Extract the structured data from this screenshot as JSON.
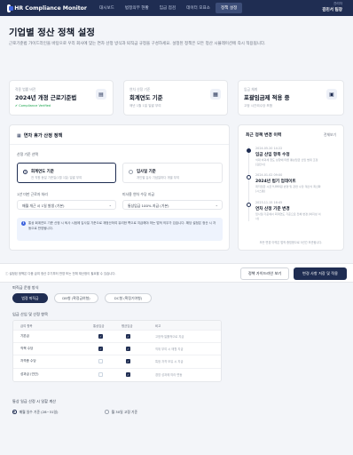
{
  "nav": {
    "app_title": "HR Compliance Monitor",
    "tabs": [
      "대시보드",
      "법정의무 현황",
      "임금 점검",
      "데이터 모표소",
      "정책 설정"
    ],
    "active_tab_index": 4,
    "user_role": "관리자",
    "user_name": "김민서 팀장"
  },
  "header": {
    "title": "기업별 정산 정책 설정",
    "description": "근로기준법 가이드라인을 바탕으로 우리 회사에 맞는 연차 산정 방식과 퇴직금 규정을 구성하세요. 설정된 정책은 모든 정산 시뮬레이션에 즉시 적용됩니다."
  },
  "summary": [
    {
      "label": "적용 법률 버전",
      "value": "2024년 개정 근로기준법",
      "sub": "Compliance Verified",
      "icon": "document-icon",
      "sub_status": "ok"
    },
    {
      "label": "연차 산정 기준",
      "value": "회계연도 기준",
      "sub": "매년 1월 1일 일괄 부여",
      "icon": "calendar-icon"
    },
    {
      "label": "임금 체계",
      "value": "포괄임금제 적용 중",
      "sub": "고정 시간외수당 포함",
      "icon": "wallet-icon"
    }
  ],
  "policy": {
    "title": "연차 휴가 산정 정책",
    "basis_label": "산정 기준 선택",
    "options": [
      {
        "title": "회계연도 기준",
        "desc": "전 직원 동일 기준일(1월 1일) 일괄 부여",
        "selected": true
      },
      {
        "title": "입사일 기준",
        "desc": "개인별 입사 기념일마다 개별 부여",
        "selected": false
      }
    ],
    "first_year_label": "1년 미만 근로자 처리",
    "first_year_value": "매월 개근 시 1일 발생 (기본)",
    "unused_label": "미사용 연차 수당 지급",
    "unused_value": "통상임금 100% 지급 (기본)",
    "info_text": "통상 회계연도 기준 산정 시 퇴사 시점에 입사일 기준으로 재정산하여 유리한 쪽으로 지급해야 하는 법적 의무가 있습니다. 해당 설정은 정산 시 자동으로 반영됩니다."
  },
  "history": {
    "title": "최근 정책 변경 이력",
    "more": "전체보기",
    "items": [
      {
        "time": "2024.05.20 14:22",
        "title": "임금 산입 항목 수정",
        "desc": "식대 비과세 한도 상향에 따른 통상임금 산입 범위 조정 (김민서)"
      },
      {
        "time": "2024.01.02 09:00",
        "title": "2024년 법기 업데이트",
        "desc": "최저임금 시급 9,860원 반영 및 관련 수당 계산식 최신화 (시스템)"
      },
      {
        "time": "2023.11.15 16:45",
        "title": "연차 산정 기준 변경",
        "desc": "입사일 기준에서 회계연도 기준으로 전체 변경 (박지성 이사)"
      }
    ],
    "footer": "모든 변경 이력은 법적 증빙용으로 5년간 보관됩니다."
  },
  "actionbar": {
    "note": "설정된 정책은 다음 급여 정산 주기부터 반영 또는 전체 재산정이 필요할 수 있습니다.",
    "guide_button": "정책 가이드라인 보기",
    "save_button": "변경 사항 저장 및 적용"
  },
  "lower": {
    "retire_label": "퇴직금 운영 방식",
    "pills": [
      "법정 퇴직금",
      "DB형 (확정급여형)",
      "DC형 (확정기여형)"
    ],
    "active_pill": 0,
    "wage_label": "임금 산입 및 산정 항목",
    "table_headers": [
      "급여 항목",
      "통상임금",
      "평균임금",
      "비고"
    ],
    "rows": [
      {
        "item": "기본급",
        "normal": true,
        "average": true,
        "note": "고정적·일률적으로 지급"
      },
      {
        "item": "직책 수당",
        "normal": true,
        "average": true,
        "note": "직위 부여 시 매월 지급"
      },
      {
        "item": "자격증 수당",
        "normal": false,
        "average": true,
        "note": "특정 자격 보유 시 지급"
      },
      {
        "item": "성과급 (연간)",
        "normal": false,
        "average": true,
        "note": "경영 성과에 따라 변동"
      }
    ],
    "daily_label": "통상 일급 산정 시 일할 계산",
    "daily_options": [
      {
        "label": "매월 일수 기준 (28~31일)",
        "selected": true
      },
      {
        "label": "월 30일 고정 기준",
        "selected": false
      }
    ]
  }
}
